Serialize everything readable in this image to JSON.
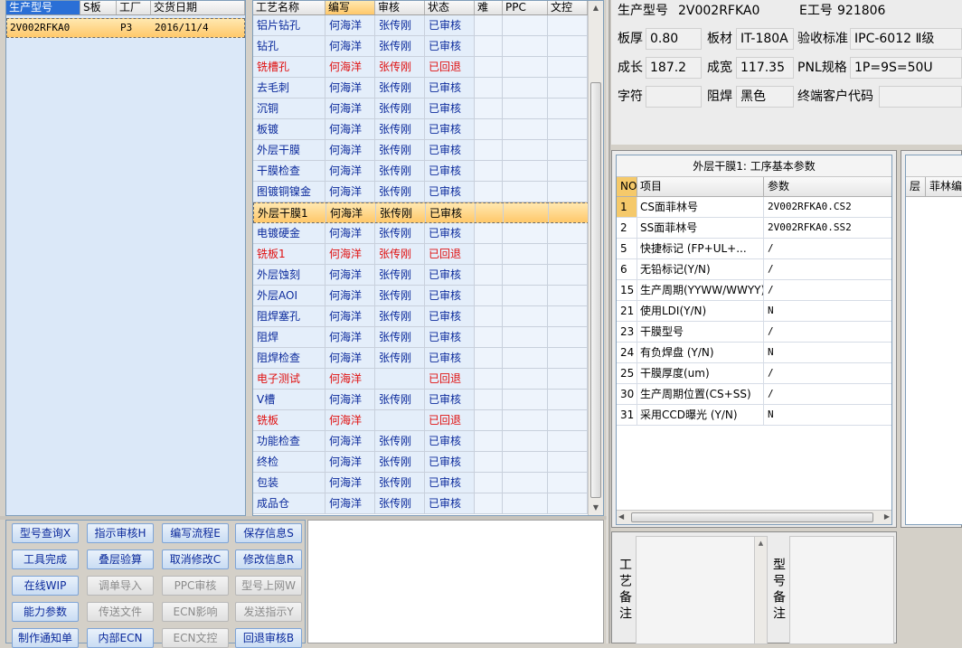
{
  "order_grid": {
    "headers": [
      "生产型号",
      "S板",
      "工厂",
      "交货日期"
    ],
    "rows": [
      {
        "model": "2V002RFKA0",
        "s": "",
        "factory": "P3",
        "date": "2016/11/4"
      }
    ]
  },
  "process_grid": {
    "headers": [
      "工艺名称",
      "编写",
      "审核",
      "状态",
      "难",
      "PPC",
      "文控"
    ],
    "rows": [
      {
        "name": "铝片钻孔",
        "writer": "何海洋",
        "reviewer": "张传刚",
        "status": "已审核",
        "color": "blue"
      },
      {
        "name": "钻孔",
        "writer": "何海洋",
        "reviewer": "张传刚",
        "status": "已审核",
        "color": "blue"
      },
      {
        "name": "铣槽孔",
        "writer": "何海洋",
        "reviewer": "张传刚",
        "status": "已回退",
        "color": "red"
      },
      {
        "name": "去毛刺",
        "writer": "何海洋",
        "reviewer": "张传刚",
        "status": "已审核",
        "color": "blue"
      },
      {
        "name": "沉铜",
        "writer": "何海洋",
        "reviewer": "张传刚",
        "status": "已审核",
        "color": "blue"
      },
      {
        "name": "板镀",
        "writer": "何海洋",
        "reviewer": "张传刚",
        "status": "已审核",
        "color": "blue"
      },
      {
        "name": "外层干膜",
        "writer": "何海洋",
        "reviewer": "张传刚",
        "status": "已审核",
        "color": "blue"
      },
      {
        "name": "干膜检查",
        "writer": "何海洋",
        "reviewer": "张传刚",
        "status": "已审核",
        "color": "blue"
      },
      {
        "name": "图镀铜镍金",
        "writer": "何海洋",
        "reviewer": "张传刚",
        "status": "已审核",
        "color": "blue"
      },
      {
        "name": "外层干膜1",
        "writer": "何海洋",
        "reviewer": "张传刚",
        "status": "已审核",
        "color": "black",
        "selected": true
      },
      {
        "name": "电镀硬金",
        "writer": "何海洋",
        "reviewer": "张传刚",
        "status": "已审核",
        "color": "blue"
      },
      {
        "name": "铣板1",
        "writer": "何海洋",
        "reviewer": "张传刚",
        "status": "已回退",
        "color": "red"
      },
      {
        "name": "外层蚀刻",
        "writer": "何海洋",
        "reviewer": "张传刚",
        "status": "已审核",
        "color": "blue"
      },
      {
        "name": "外层AOI",
        "writer": "何海洋",
        "reviewer": "张传刚",
        "status": "已审核",
        "color": "blue"
      },
      {
        "name": "阻焊塞孔",
        "writer": "何海洋",
        "reviewer": "张传刚",
        "status": "已审核",
        "color": "blue"
      },
      {
        "name": "阻焊",
        "writer": "何海洋",
        "reviewer": "张传刚",
        "status": "已审核",
        "color": "blue"
      },
      {
        "name": "阻焊检查",
        "writer": "何海洋",
        "reviewer": "张传刚",
        "status": "已审核",
        "color": "blue"
      },
      {
        "name": "电子测试",
        "writer": "何海洋",
        "reviewer": "",
        "status": "已回退",
        "color": "red"
      },
      {
        "name": "V槽",
        "writer": "何海洋",
        "reviewer": "张传刚",
        "status": "已审核",
        "color": "blue"
      },
      {
        "name": "铣板",
        "writer": "何海洋",
        "reviewer": "",
        "status": "已回退",
        "color": "red"
      },
      {
        "name": "功能检查",
        "writer": "何海洋",
        "reviewer": "张传刚",
        "status": "已审核",
        "color": "blue"
      },
      {
        "name": "终检",
        "writer": "何海洋",
        "reviewer": "张传刚",
        "status": "已审核",
        "color": "blue"
      },
      {
        "name": "包装",
        "writer": "何海洋",
        "reviewer": "张传刚",
        "status": "已审核",
        "color": "blue"
      },
      {
        "name": "成品仓",
        "writer": "何海洋",
        "reviewer": "张传刚",
        "status": "已审核",
        "color": "blue"
      }
    ]
  },
  "info": {
    "model_label": "生产型号",
    "model_value": "2V002RFKA0",
    "e_label": "E工号",
    "e_value": "921806",
    "thickness_label": "板厚",
    "thickness_value": "0.80",
    "material_label": "板材",
    "material_value": "IT-180A",
    "standard_label": "验收标准",
    "standard_value": "IPC-6012 Ⅱ级",
    "length_label": "成长",
    "length_value": "187.2",
    "width_label": "成宽",
    "width_value": "117.35",
    "pnl_label": "PNL规格",
    "pnl_value": "1P=9S=50U",
    "char_label": "字符",
    "char_value": "",
    "mask_label": "阻焊",
    "mask_value": "黑色",
    "customer_label": "终端客户代码",
    "customer_value": ""
  },
  "params": {
    "title": "外层干膜1: 工序基本参数",
    "headers": [
      "NO",
      "项目",
      "参数"
    ],
    "rows": [
      {
        "no": "1",
        "item": "CS面菲林号",
        "value": "2V002RFKA0.CS2",
        "selected": true
      },
      {
        "no": "2",
        "item": "SS面菲林号",
        "value": "2V002RFKA0.SS2"
      },
      {
        "no": "5",
        "item": "快捷标记 (FP+UL+...",
        "value": "/"
      },
      {
        "no": "6",
        "item": "无铅标记(Y/N)",
        "value": "/"
      },
      {
        "no": "15",
        "item": "生产周期(YYWW/WWYY)",
        "value": "/"
      },
      {
        "no": "21",
        "item": "使用LDI(Y/N)",
        "value": "N"
      },
      {
        "no": "23",
        "item": "干膜型号",
        "value": "/"
      },
      {
        "no": "24",
        "item": "有负焊盘 (Y/N)",
        "value": "N"
      },
      {
        "no": "25",
        "item": "干膜厚度(um)",
        "value": "/"
      },
      {
        "no": "30",
        "item": "生产周期位置(CS+SS)",
        "value": "/"
      },
      {
        "no": "31",
        "item": "采用CCD曝光 (Y/N)",
        "value": "N"
      }
    ]
  },
  "layer_panel": {
    "col1": "层",
    "col2": "菲林编"
  },
  "remarks": {
    "process_label": "工艺备注",
    "model_label": "型号备注"
  },
  "buttons": [
    {
      "label": "型号查询X",
      "disabled": false
    },
    {
      "label": "指示审核H",
      "disabled": false
    },
    {
      "label": "编写流程E",
      "disabled": false
    },
    {
      "label": "保存信息S",
      "disabled": false
    },
    {
      "label": "工具完成",
      "disabled": false
    },
    {
      "label": "叠层验算",
      "disabled": false
    },
    {
      "label": "取消修改C",
      "disabled": false
    },
    {
      "label": "修改信息R",
      "disabled": false
    },
    {
      "label": "在线WIP",
      "disabled": false
    },
    {
      "label": "调单导入",
      "disabled": true
    },
    {
      "label": "PPC审核",
      "disabled": true
    },
    {
      "label": "型号上网W",
      "disabled": true
    },
    {
      "label": "能力参数",
      "disabled": false
    },
    {
      "label": "传送文件",
      "disabled": true
    },
    {
      "label": "ECN影响",
      "disabled": true
    },
    {
      "label": "发送指示Y",
      "disabled": true
    },
    {
      "label": "制作通知单",
      "disabled": false
    },
    {
      "label": "内部ECN",
      "disabled": false
    },
    {
      "label": "ECN文控",
      "disabled": true
    },
    {
      "label": "回退审核B",
      "disabled": false
    }
  ]
}
